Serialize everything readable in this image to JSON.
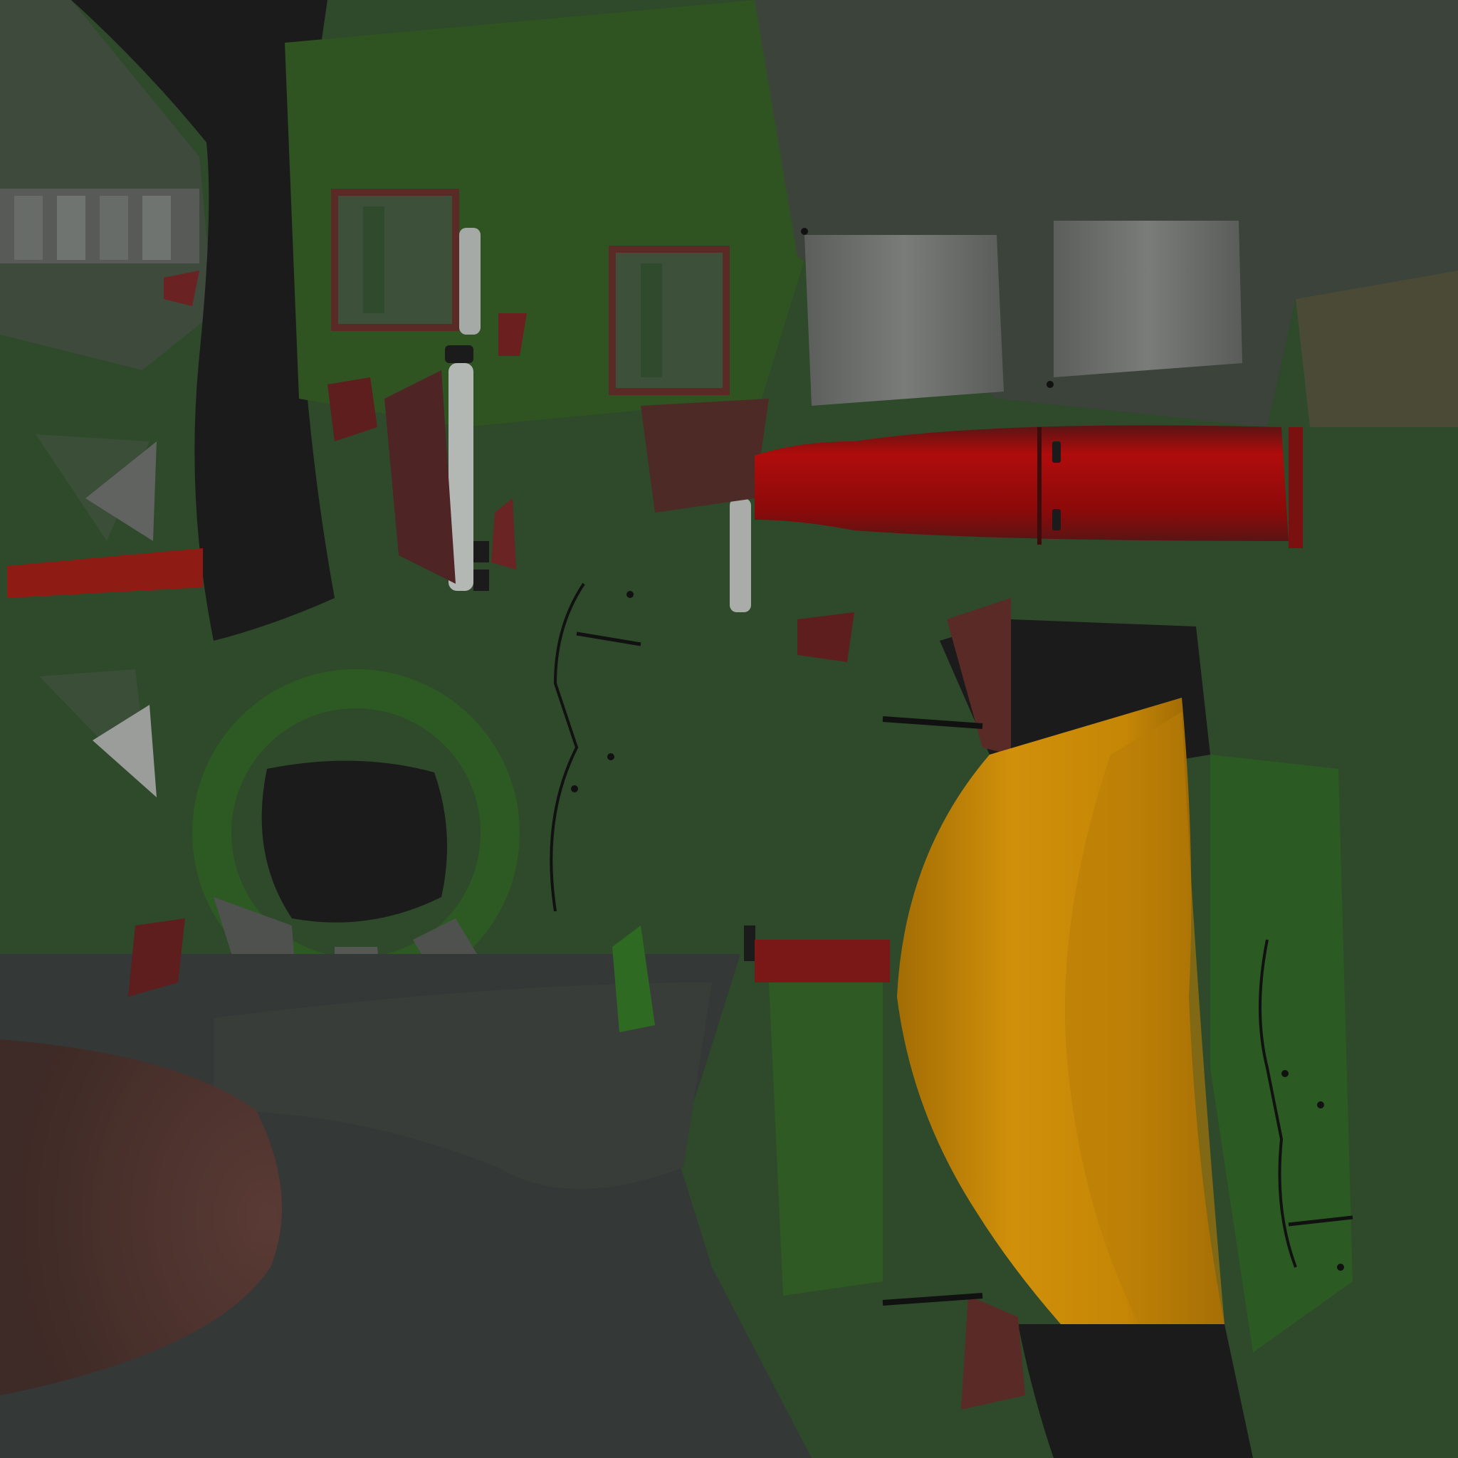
{
  "texture": {
    "description_visible_text": "",
    "palette": {
      "base_green": "#2e4a2a",
      "bright_green": "#2f5e22",
      "dark_slate": "#333735",
      "mid_slate": "#3b403c",
      "black": "#1b1b1b",
      "red": "#9a0c0c",
      "dark_red": "#5a1e1e",
      "maroon": "#4a2424",
      "yellow_ochre": "#c88a07",
      "dark_ochre": "#8c5e04",
      "grey_panel": "#6e706e",
      "light_grey": "#b8bcb8",
      "brown_wood": "#5c3a32",
      "olive": "#4a4a36"
    }
  }
}
